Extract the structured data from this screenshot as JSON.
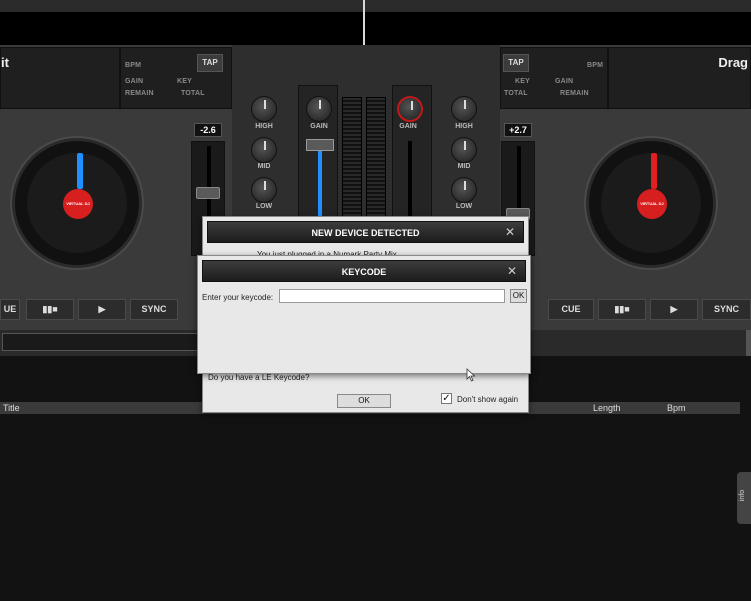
{
  "deck_left": {
    "title": "it",
    "labels": {
      "bpm": "BPM",
      "tap": "TAP",
      "gain": "GAIN",
      "key": "KEY",
      "remain": "REMAIN",
      "total": "TOTAL"
    },
    "pitch": "-2.6",
    "disc_label": "VIRTUAL DJ",
    "buttons": {
      "cue": "UE",
      "pause": "▮▮■",
      "play": "▶",
      "sync": "SYNC"
    }
  },
  "deck_right": {
    "title": "Drag",
    "labels": {
      "bpm": "BPM",
      "tap": "TAP",
      "gain": "GAIN",
      "key": "KEY",
      "remain": "REMAIN",
      "total": "TOTAL"
    },
    "pitch": "+2.7",
    "disc_label": "VIRTUAL DJ",
    "buttons": {
      "cue": "CUE",
      "pause": "▮▮■",
      "play": "▶",
      "sync": "SYNC"
    }
  },
  "mixer": {
    "left": {
      "high": "HIGH",
      "mid": "MID",
      "low": "LOW"
    },
    "right": {
      "high": "HIGH",
      "mid": "MID",
      "low": "LOW"
    },
    "gain_left": "GAIN",
    "gain_right": "GAIN"
  },
  "browser": {
    "columns": {
      "title": "Title",
      "length": "Length",
      "bpm": "Bpm"
    },
    "info_tab": "info"
  },
  "dialog_device": {
    "title": "NEW DEVICE DETECTED",
    "close": "✕",
    "message": "You just plugged in a Numark Party Mix",
    "question": "Do you have a LE Keycode?",
    "ok": "OK",
    "dont_show": "Don't show again",
    "dont_show_checked": true
  },
  "dialog_keycode": {
    "title": "KEYCODE",
    "close": "✕",
    "prompt": "Enter your keycode:",
    "input_value": "",
    "ok": "OK"
  },
  "colors": {
    "left_needle": "#1e90ff",
    "right_needle": "#e02020",
    "disc_label": "#d71f1f"
  }
}
